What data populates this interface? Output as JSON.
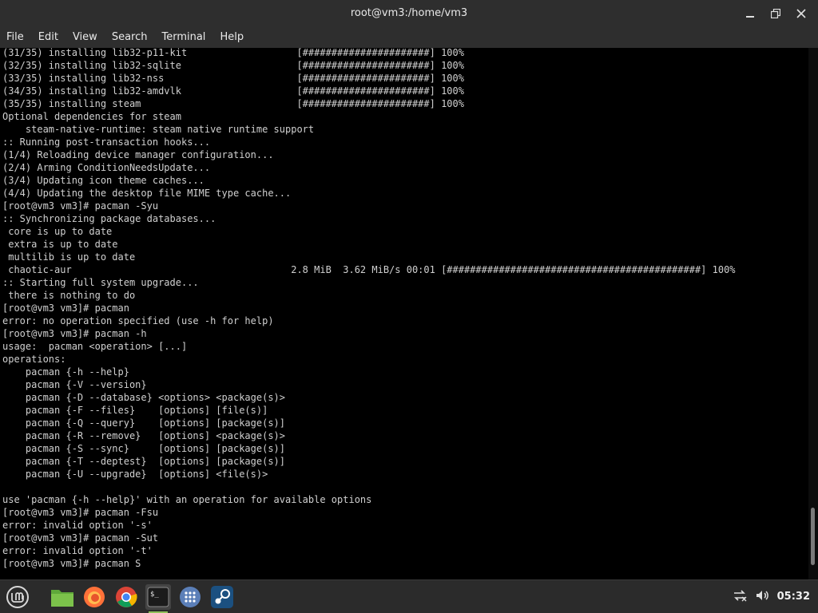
{
  "window": {
    "title": "root@vm3:/home/vm3"
  },
  "window_controls": {
    "minimize_icon": "minimize-icon",
    "maximize_icon": "maximize-icon",
    "close_icon": "close-icon"
  },
  "menu": [
    "File",
    "Edit",
    "View",
    "Search",
    "Terminal",
    "Help"
  ],
  "terminal": {
    "lines": [
      "(31/35) installing lib32-p11-kit                   [######################] 100%",
      "(32/35) installing lib32-sqlite                    [######################] 100%",
      "(33/35) installing lib32-nss                       [######################] 100%",
      "(34/35) installing lib32-amdvlk                    [######################] 100%",
      "(35/35) installing steam                           [######################] 100%",
      "Optional dependencies for steam",
      "    steam-native-runtime: steam native runtime support",
      ":: Running post-transaction hooks...",
      "(1/4) Reloading device manager configuration...",
      "(2/4) Arming ConditionNeedsUpdate...",
      "(3/4) Updating icon theme caches...",
      "(4/4) Updating the desktop file MIME type cache...",
      "[root@vm3 vm3]# pacman -Syu",
      ":: Synchronizing package databases...",
      " core is up to date",
      " extra is up to date",
      " multilib is up to date",
      " chaotic-aur                                      2.8 MiB  3.62 MiB/s 00:01 [############################################] 100%",
      ":: Starting full system upgrade...",
      " there is nothing to do",
      "[root@vm3 vm3]# pacman",
      "error: no operation specified (use -h for help)",
      "[root@vm3 vm3]# pacman -h",
      "usage:  pacman <operation> [...]",
      "operations:",
      "    pacman {-h --help}",
      "    pacman {-V --version}",
      "    pacman {-D --database} <options> <package(s)>",
      "    pacman {-F --files}    [options] [file(s)]",
      "    pacman {-Q --query}    [options] [package(s)]",
      "    pacman {-R --remove}   [options] <package(s)>",
      "    pacman {-S --sync}     [options] [package(s)]",
      "    pacman {-T --deptest}  [options] [package(s)]",
      "    pacman {-U --upgrade}  [options] <file(s)>",
      "",
      "use 'pacman {-h --help}' with an operation for available options",
      "[root@vm3 vm3]# pacman -Fsu",
      "error: invalid option '-s'",
      "[root@vm3 vm3]# pacman -Sut",
      "error: invalid option '-t'",
      "[root@vm3 vm3]# pacman S"
    ],
    "scroll_position": 0.97
  },
  "taskbar": {
    "apps": [
      {
        "name": "linux-mint-menu-icon",
        "active": false
      },
      {
        "name": "files-folder-icon",
        "active": false
      },
      {
        "name": "firefox-icon",
        "active": false
      },
      {
        "name": "chrome-icon",
        "active": false
      },
      {
        "name": "terminal-icon",
        "active": true
      },
      {
        "name": "app-grid-icon",
        "active": false
      },
      {
        "name": "steam-icon",
        "active": false
      }
    ],
    "tray": {
      "network_icon": "network-disconnected-icon",
      "volume_icon": "volume-icon",
      "clock": "05:32"
    }
  },
  "colors": {
    "titlebar": "#2e2e2e",
    "terminal_bg": "#000000",
    "terminal_fg": "#d0d0d0",
    "taskbar": "#2b2b2b",
    "accent": "#8fbf5a"
  }
}
